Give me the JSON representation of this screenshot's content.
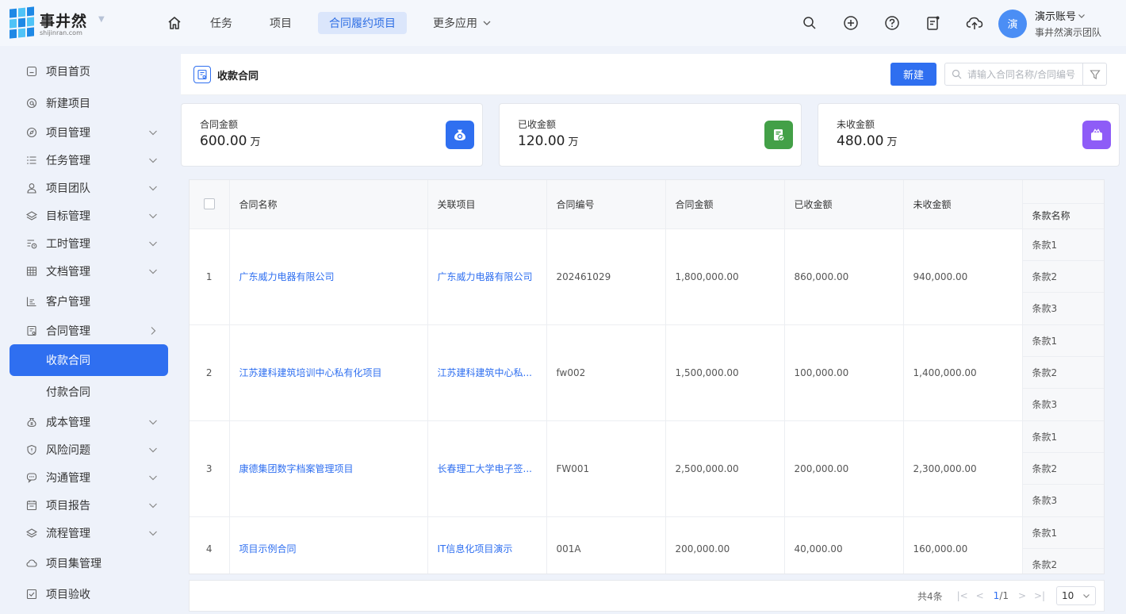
{
  "app": {
    "name": "事井然",
    "url": "shijinran.com"
  },
  "nav": {
    "items": [
      {
        "label": "任务"
      },
      {
        "label": "项目"
      },
      {
        "label": "合同履约项目"
      },
      {
        "label": "更多应用"
      }
    ]
  },
  "user": {
    "avatar_text": "演",
    "name": "演示账号",
    "team": "事井然演示团队"
  },
  "sidebar": {
    "items": [
      {
        "label": "项目首页",
        "icon": "home-icon"
      },
      {
        "label": "新建项目",
        "icon": "at-icon"
      },
      {
        "label": "项目管理",
        "icon": "compass-icon"
      },
      {
        "label": "任务管理",
        "icon": "list-icon"
      },
      {
        "label": "项目团队",
        "icon": "user-icon"
      },
      {
        "label": "目标管理",
        "icon": "layers-icon"
      },
      {
        "label": "工时管理",
        "icon": "clock-list-icon"
      },
      {
        "label": "文档管理",
        "icon": "table-icon"
      },
      {
        "label": "客户管理",
        "icon": "chart-icon"
      },
      {
        "label": "合同管理",
        "icon": "contract-icon"
      },
      {
        "label": "收款合同",
        "icon": ""
      },
      {
        "label": "付款合同",
        "icon": ""
      },
      {
        "label": "成本管理",
        "icon": "money-bag-icon"
      },
      {
        "label": "风险问题",
        "icon": "shield-icon"
      },
      {
        "label": "沟通管理",
        "icon": "chat-icon"
      },
      {
        "label": "项目报告",
        "icon": "report-icon"
      },
      {
        "label": "流程管理",
        "icon": "layers-icon"
      },
      {
        "label": "项目集管理",
        "icon": "cloud-icon"
      },
      {
        "label": "项目验收",
        "icon": "check-square-icon"
      }
    ]
  },
  "page": {
    "title": "收款合同",
    "new_button": "新建",
    "search_placeholder": "请输入合同名称/合同编号"
  },
  "stats": [
    {
      "label": "合同金额",
      "value": "600.00",
      "unit": "万",
      "color": "#2f6ff0"
    },
    {
      "label": "已收金额",
      "value": "120.00",
      "unit": "万",
      "color": "#43a047"
    },
    {
      "label": "未收金额",
      "value": "480.00",
      "unit": "万",
      "color": "#8e5cf7"
    }
  ],
  "table": {
    "headers": [
      "合同名称",
      "关联项目",
      "合同编号",
      "合同金额",
      "已收金额",
      "未收金额",
      "条款名称"
    ],
    "rows": [
      {
        "idx": "1",
        "name": "广东威力电器有限公司",
        "project": "广东威力电器有限公司",
        "code": "202461029",
        "amount": "1,800,000.00",
        "received": "860,000.00",
        "unreceived": "940,000.00",
        "clauses": [
          "条款1",
          "条款2",
          "条款3"
        ]
      },
      {
        "idx": "2",
        "name": "江苏建科建筑培训中心私有化项目",
        "project": "江苏建科建筑中心私...",
        "code": "fw002",
        "amount": "1,500,000.00",
        "received": "100,000.00",
        "unreceived": "1,400,000.00",
        "clauses": [
          "条款1",
          "条款2",
          "条款3"
        ]
      },
      {
        "idx": "3",
        "name": "康德集团数字档案管理项目",
        "project": "长春理工大学电子签...",
        "code": "FW001",
        "amount": "2,500,000.00",
        "received": "200,000.00",
        "unreceived": "2,300,000.00",
        "clauses": [
          "条款1",
          "条款2",
          "条款3"
        ]
      },
      {
        "idx": "4",
        "name": "项目示例合同",
        "project": "IT信息化项目演示",
        "code": "001A",
        "amount": "200,000.00",
        "received": "40,000.00",
        "unreceived": "160,000.00",
        "clauses": [
          "条款1",
          "条款2"
        ]
      }
    ]
  },
  "pager": {
    "total": "共4条",
    "current": "1",
    "pages": "/1",
    "size": "10"
  }
}
